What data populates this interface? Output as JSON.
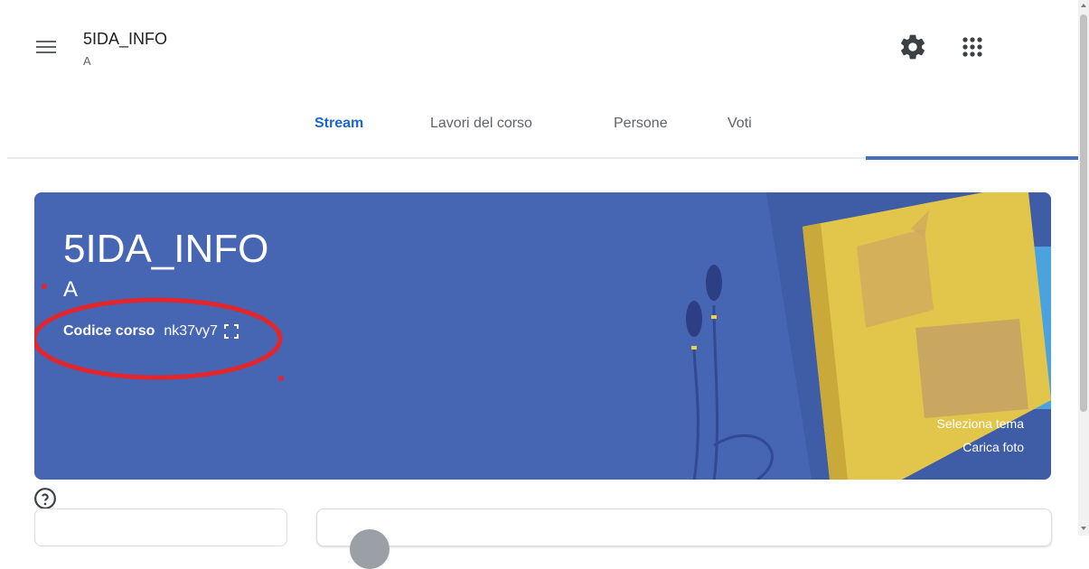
{
  "header": {
    "class_name": "5IDA_INFO",
    "section": "A",
    "settings_icon": "gear-icon",
    "apps_icon": "apps-grid-icon",
    "menu_icon": "hamburger-menu-icon"
  },
  "tabs": [
    {
      "label": "Stream",
      "active": true
    },
    {
      "label": "Lavori del corso",
      "active": false
    },
    {
      "label": "Persone",
      "active": false
    },
    {
      "label": "Voti",
      "active": false
    }
  ],
  "banner": {
    "title": "5IDA_INFO",
    "section": "A",
    "code_label": "Codice corso",
    "code_value": "nk37vy7",
    "select_theme": "Seleziona tema",
    "upload_photo": "Carica foto",
    "background_color": "#4665b3",
    "annotation_color": "#e3262b"
  },
  "help_icon": "help-circle-icon",
  "colors": {
    "accent": "#1967d2",
    "tab_indicator": "#4a6fbf"
  }
}
